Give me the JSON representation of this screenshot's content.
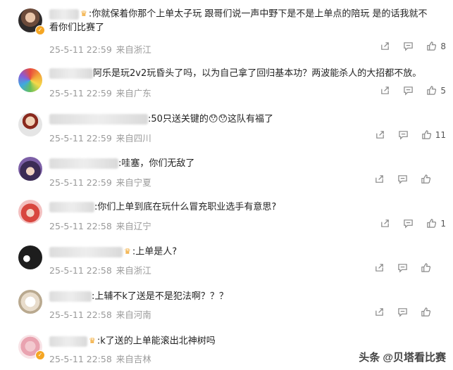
{
  "comments": [
    {
      "meta": {
        "time": "25-5-11 22:59",
        "location": "来自浙江"
      },
      "text": ":你就保着你那个上单太子玩 跟哥们说一声中野下是不是上单点的陪玩 是的话我就不",
      "text2": "看你们比赛了",
      "likes": "8"
    },
    {
      "meta": {
        "time": "25-5-11 22:59",
        "location": "来自广东"
      },
      "text": "阿乐是玩2v2玩昏头了吗，以为自己拿了回归基本功？两波能杀人的大招都不放。",
      "likes": "5"
    },
    {
      "meta": {
        "time": "25-5-11 22:59",
        "location": "来自四川"
      },
      "text": ":50只送关键的",
      "text_suffix": "这队有福了",
      "emoji": "😯😯",
      "likes": "11"
    },
    {
      "meta": {
        "time": "25-5-11 22:59",
        "location": "来自宁夏"
      },
      "text": ":哇塞，你们无敌了",
      "likes": ""
    },
    {
      "meta": {
        "time": "25-5-11 22:58",
        "location": "来自辽宁"
      },
      "text": ":你们上单到底在玩什么冒充职业选手有意思?",
      "likes": "1"
    },
    {
      "meta": {
        "time": "25-5-11 22:58",
        "location": "来自浙江"
      },
      "text": ":上单是人?",
      "likes": ""
    },
    {
      "meta": {
        "time": "25-5-11 22:58",
        "location": "来自河南"
      },
      "text": ":上辅不k了送是不是犯法啊？？？",
      "likes": ""
    },
    {
      "meta": {
        "time": "25-5-11 22:58",
        "location": "来自吉林"
      },
      "text": ":k了送的上单能滚出北神树吗",
      "likes": ""
    }
  ],
  "watermark": "头条 @贝塔看比赛",
  "icons": [
    "share-icon",
    "comment-icon",
    "like-icon"
  ]
}
